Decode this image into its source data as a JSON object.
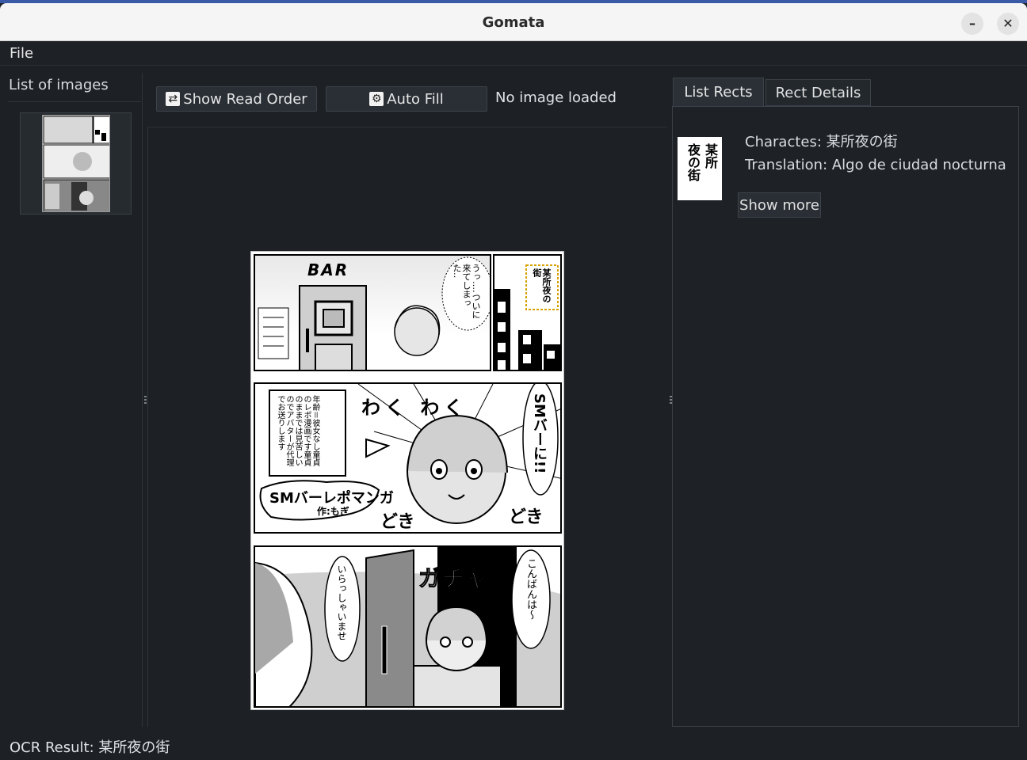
{
  "window": {
    "title": "Gomata"
  },
  "menu": {
    "file": "File"
  },
  "left_panel": {
    "title": "List of images"
  },
  "toolbar": {
    "show_read_order": "Show Read Order",
    "auto_fill": "Auto Fill",
    "status": "No image loaded"
  },
  "manga": {
    "panel1": {
      "bar": "BAR",
      "bubble": "うっ‥‥ついに来てしまった‥",
      "sign": "某所夜の街"
    },
    "panel2": {
      "note": "年齢＝彼女なし童貞のレポ漫画です童貞のままでは見苦しいのでアバターが代理でお送りします",
      "sfx1": "わく わく",
      "shout": "SMバーに!!",
      "title": "SMバーレポマンガ",
      "author": "作:もぎ",
      "sfx2": "どき",
      "sfx3": "どき"
    },
    "panel3": {
      "bubble_left": "いらっしゃいませ",
      "sfx": "ガチャ",
      "bubble_right": "こんばんは〜"
    }
  },
  "right_panel": {
    "tabs": [
      "List Rects",
      "Rect Details"
    ],
    "rect": {
      "thumb_text_col1": "某所",
      "thumb_text_col2": "夜の街",
      "characters": "Charactes: 某所夜の街",
      "translation": "Translation: Algo de ciudad nocturna",
      "show_more": "Show more"
    }
  },
  "footer": {
    "ocr_result": "OCR Result: 某所夜の街"
  }
}
